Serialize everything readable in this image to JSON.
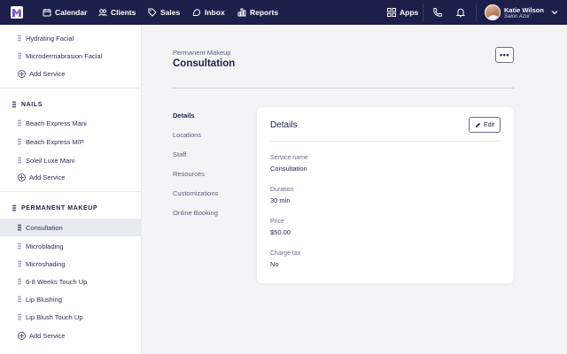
{
  "nav": {
    "items": [
      {
        "label": "Calendar",
        "icon": "calendar-icon"
      },
      {
        "label": "Clients",
        "icon": "clients-icon"
      },
      {
        "label": "Sales",
        "icon": "tag-icon"
      },
      {
        "label": "Inbox",
        "icon": "inbox-icon"
      },
      {
        "label": "Reports",
        "icon": "reports-icon"
      }
    ],
    "apps_label": "Apps",
    "user": {
      "name": "Katie Wilson",
      "salon": "Salon Azul"
    }
  },
  "sidebar": {
    "facial_items": [
      "Hydrating Facial",
      "Microdermabrasion Facial"
    ],
    "add_service_label": "Add Service",
    "nails_heading": "NAILS",
    "nails_items": [
      "Beach Express Mani",
      "Beach Express M/P",
      "Soleil Luxe Mani"
    ],
    "pm_heading": "PERMANENT MAKEUP",
    "pm_items": [
      "Consultation",
      "Microblading",
      "Microshading",
      "6-8 Weeks Touch Up",
      "Lip Blushing",
      "Lip Blush Touch Up"
    ],
    "active_item": "Consultation"
  },
  "main": {
    "breadcrumb": "Permanent Makeup",
    "title": "Consultation",
    "more_label": "•••",
    "tabs": [
      "Details",
      "Locations",
      "Staff",
      "Resources",
      "Customizations",
      "Online Booking"
    ],
    "active_tab": "Details",
    "card": {
      "title": "Details",
      "edit_label": "Edit",
      "fields": [
        {
          "label": "Service name",
          "value": "Consultation"
        },
        {
          "label": "Duration",
          "value": "30 min"
        },
        {
          "label": "Price",
          "value": "$50.00"
        },
        {
          "label": "Charge tax",
          "value": "No"
        }
      ]
    }
  },
  "colors": {
    "nav_bg": "#1c1f4a",
    "accent": "#1c1f4a",
    "page_bg": "#f4f4f7"
  }
}
